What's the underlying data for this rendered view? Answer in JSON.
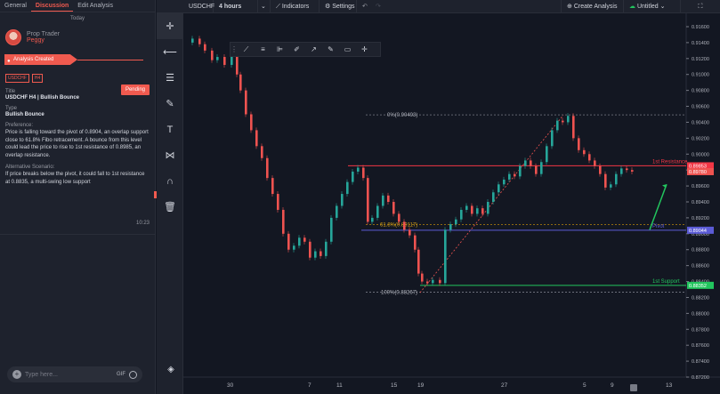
{
  "tabs": [
    "General",
    "Discussion",
    "Edit Analysis"
  ],
  "active_tab": 1,
  "today_label": "Today",
  "author": {
    "role": "Prop Trader",
    "name": "Peggy"
  },
  "event_label": "Analysis Created",
  "badges": [
    "USDCHF",
    "H4"
  ],
  "status": "Pending",
  "labels": {
    "title": "Title",
    "type": "Type",
    "preference": "Preference:",
    "alternative": "Alternative Scenario:"
  },
  "analysis": {
    "title": "USDCHF H4 | Bullish Bounce",
    "type": "Bullish Bounce",
    "preference": "Price is falling toward the pivot of 0.8904, an overlap support close to 61.8% Fibo retracement.  A bounce from this level could lead the price to rise to 1st resistance of 0.8985, an overlap resistance.",
    "alternative": "If price breaks below the pivot, it could fall to 1st resistance at 0.8835, a multi-swing low support"
  },
  "time": "10:23",
  "chat": {
    "placeholder": "Type here...",
    "gif": "GIF"
  },
  "topbar": {
    "symbol": "USDCHF",
    "interval": "4 hours",
    "indicators": "Indicators",
    "settings": "Settings",
    "create_analysis": "Create Analysis",
    "save_name": "Untitled"
  },
  "icons": {
    "crosshair": "crosshair-icon",
    "line": "trendline-icon",
    "fib": "fib-icon",
    "brush": "brush-icon",
    "text": "text-icon",
    "pattern": "pattern-icon",
    "magnet": "magnet-icon",
    "trash": "trash-icon",
    "layers": "layers-icon"
  },
  "chart_data": {
    "type": "candlestick",
    "symbol": "USDCHF",
    "ylim": [
      0.872,
      0.916
    ],
    "price_ticks": [
      "0.91600",
      "0.91400",
      "0.91200",
      "0.91000",
      "0.90800",
      "0.90600",
      "0.90400",
      "0.90200",
      "0.90000",
      "0.89800",
      "0.89600",
      "0.89400",
      "0.89200",
      "0.89000",
      "0.88800",
      "0.88600",
      "0.88400",
      "0.88200",
      "0.88000",
      "0.87800",
      "0.87600",
      "0.87400",
      "0.87200"
    ],
    "x_labels": [
      "30",
      "7",
      "11",
      "15",
      "19",
      "27",
      "5",
      "9",
      "13"
    ],
    "levels": [
      {
        "name": "1st Resistance",
        "price": 0.89853,
        "label": "0.89853",
        "color": "#f23645"
      },
      {
        "name": "Pivot",
        "price": 0.89044,
        "label": "0.89044",
        "color": "#5b5bd6"
      },
      {
        "name": "1st Support",
        "price": 0.88352,
        "label": "0.88352",
        "color": "#22c55e"
      }
    ],
    "current_price": "0.89780",
    "fib": [
      {
        "label": "0%(0.90493)",
        "price": 0.90493
      },
      {
        "label": "61.8%(0.89117)",
        "price": 0.89117
      },
      {
        "label": "100%(0.88267)",
        "price": 0.88267
      }
    ],
    "colors": {
      "up": "#26a69a",
      "down": "#ef5350",
      "arrow": "#22c55e"
    }
  }
}
